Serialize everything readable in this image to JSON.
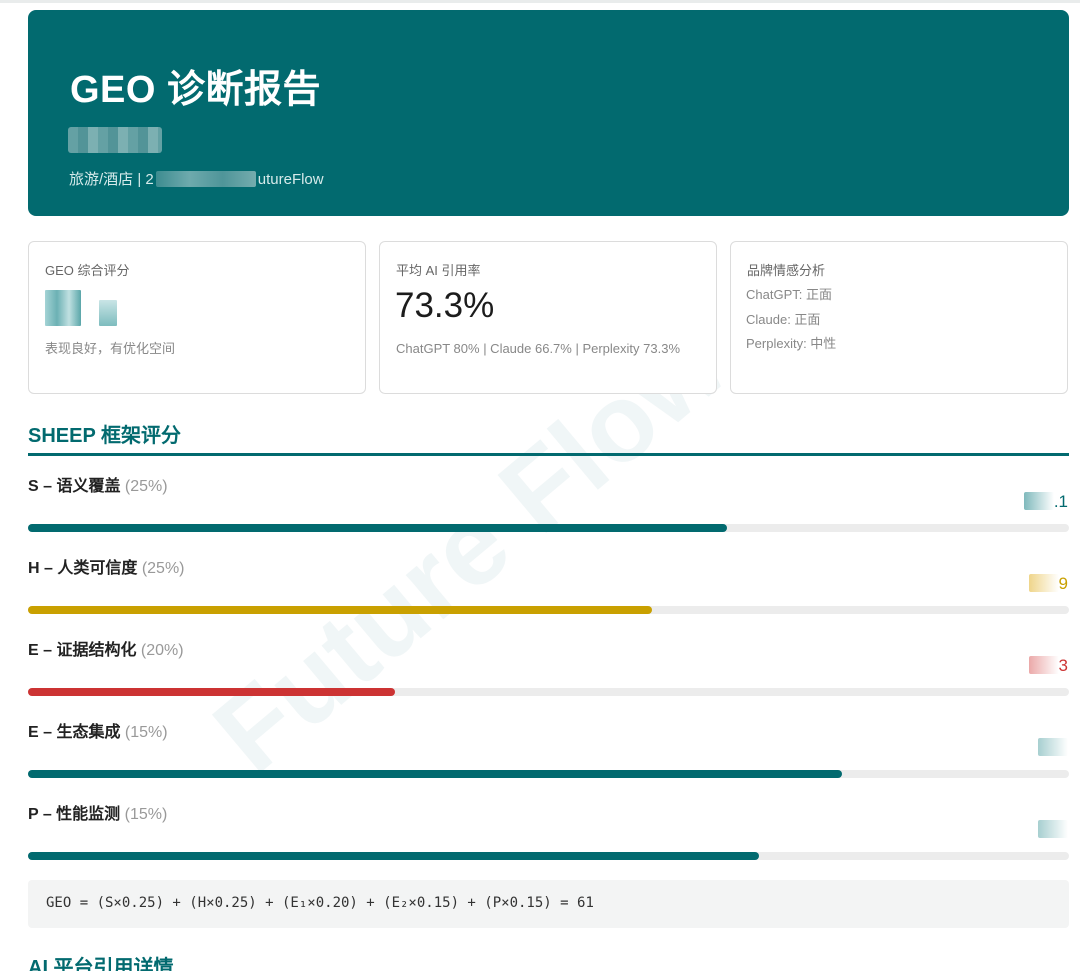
{
  "header": {
    "title": "GEO 诊断报告",
    "meta_prefix": "旅游/酒店 | 2",
    "meta_suffix": "utureFlow"
  },
  "cards": {
    "overall": {
      "label": "GEO 综合评分",
      "note": "表现良好，有优化空间"
    },
    "citation": {
      "label": "平均 AI 引用率",
      "value": "73.3%",
      "breakdown": "ChatGPT 80% | Claude 66.7% | Perplexity 73.3%"
    },
    "sentiment": {
      "label": "品牌情感分析",
      "items": [
        "ChatGPT: 正面",
        "Claude: 正面",
        "Perplexity: 中性"
      ]
    }
  },
  "sheep": {
    "title": "SHEEP 框架评分",
    "metrics": [
      {
        "name": "S – 语义覆盖",
        "weight": "(25%)",
        "score_tail": ".1",
        "fraction": 0.671,
        "color": "#026a6f",
        "blur_color": "#7fb9bc"
      },
      {
        "name": "H – 人类可信度",
        "weight": "(25%)",
        "score_tail": "9",
        "fraction": 0.599,
        "color": "#c9a000",
        "blur_color": "#efd58a"
      },
      {
        "name": "E – 证据结构化",
        "weight": "(20%)",
        "score_tail": "3",
        "fraction": 0.353,
        "color": "#cc3333",
        "blur_color": "#eba9a9"
      },
      {
        "name": "E – 生态集成",
        "weight": "(15%)",
        "score_tail": "",
        "fraction": 0.782,
        "color": "#026a6f",
        "blur_color": "#a7cfd0"
      },
      {
        "name": "P – 性能监测",
        "weight": "(15%)",
        "score_tail": "",
        "fraction": 0.702,
        "color": "#026a6f",
        "blur_color": "#a7cfd0"
      }
    ],
    "formula": "GEO = (S×0.25) + (H×0.25) + (E₁×0.20) + (E₂×0.15) + (P×0.15) = 61"
  },
  "next_section_title": "AI 平台引用详情",
  "watermark": "Future Flow",
  "colors": {
    "primary": "#026a6f",
    "warning": "#c9a000",
    "danger": "#cc3333",
    "track": "#ececec"
  }
}
